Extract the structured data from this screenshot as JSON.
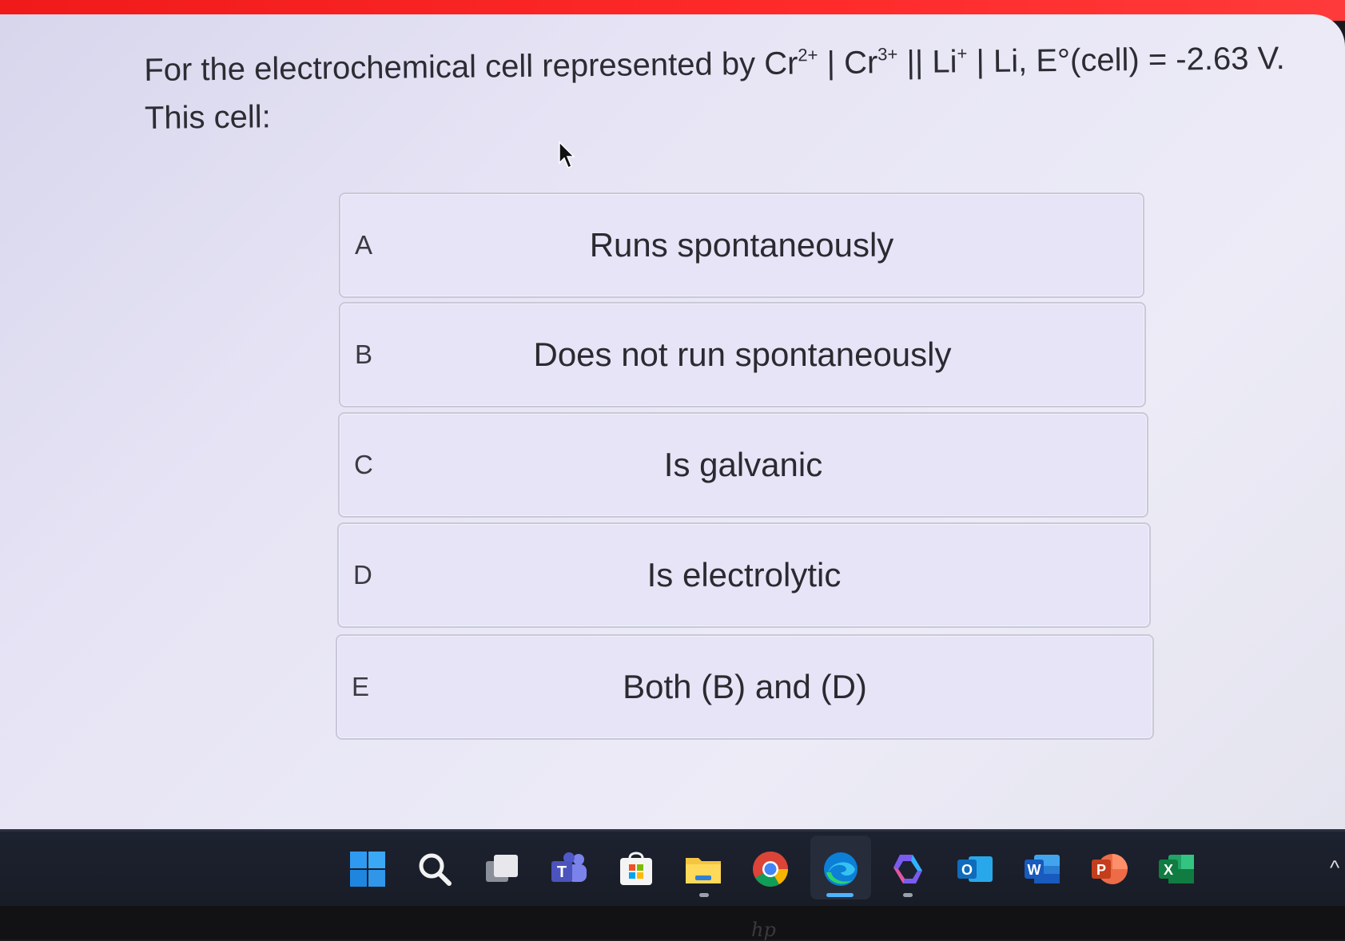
{
  "question": {
    "prefix": "For the electrochemical cell represented by Cr",
    "cr_charge_1": "2+",
    "sep1": " | Cr",
    "cr_charge_2": "3+",
    "sep2": " || Li",
    "li_charge": "+",
    "suffix": " | Li, E°(cell) = -2.63 V.",
    "line2": "This cell:"
  },
  "options": [
    {
      "letter": "A",
      "text": "Runs spontaneously"
    },
    {
      "letter": "B",
      "text": "Does not run spontaneously"
    },
    {
      "letter": "C",
      "text": "Is galvanic"
    },
    {
      "letter": "D",
      "text": "Is electrolytic"
    },
    {
      "letter": "E",
      "text": "Both (B) and (D)"
    }
  ],
  "taskbar": {
    "icons": [
      "windows-start-icon",
      "search-icon",
      "task-view-icon",
      "teams-icon",
      "store-icon",
      "file-explorer-icon",
      "chrome-icon",
      "edge-icon",
      "copilot-icon",
      "outlook-icon",
      "word-icon",
      "powerpoint-icon",
      "excel-icon"
    ],
    "teams_letter": "T",
    "outlook_letter": "O",
    "word_letter": "W",
    "powerpoint_letter": "P",
    "excel_letter": "X",
    "bezel_logo": "hp",
    "overflow_chevron": "^"
  },
  "colors": {
    "accent_red": "#ff2020",
    "background": "#e7e5f5",
    "option_bg": "#e6e4f6",
    "taskbar": "#1d2230"
  }
}
